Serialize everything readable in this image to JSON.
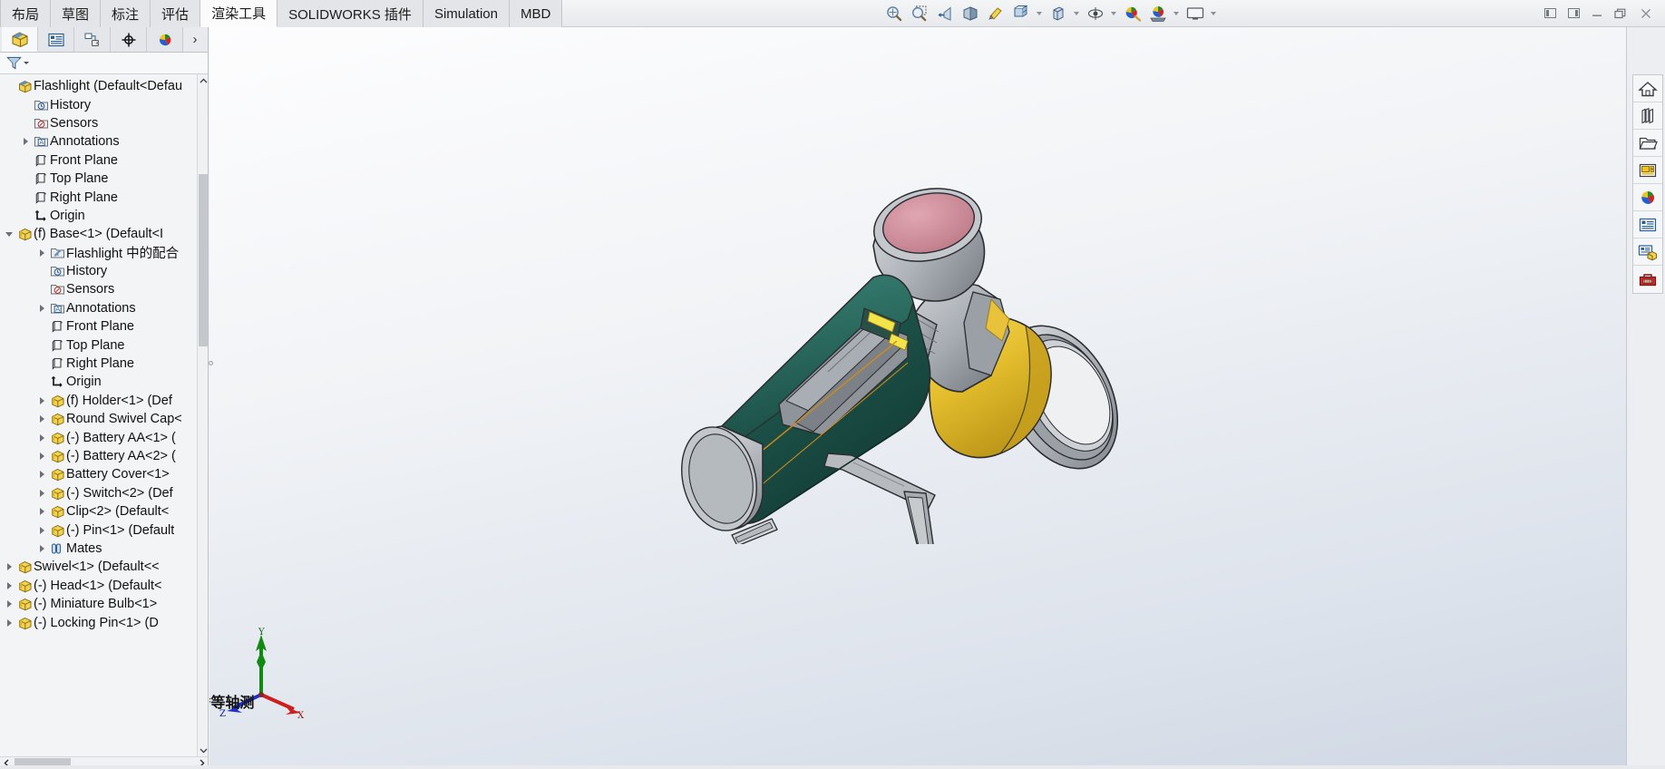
{
  "window": {
    "controls": [
      {
        "name": "restore-left-icon",
        "glyph": "◁"
      },
      {
        "name": "restore-right-icon",
        "glyph": "▷"
      },
      {
        "name": "minimize-icon",
        "glyph": "—"
      },
      {
        "name": "restore-icon",
        "glyph": "❐"
      },
      {
        "name": "close-icon",
        "glyph": "✕"
      }
    ]
  },
  "ribbon": {
    "tabs": [
      {
        "label": "布局",
        "active": false
      },
      {
        "label": "草图",
        "active": false
      },
      {
        "label": "标注",
        "active": false
      },
      {
        "label": "评估",
        "active": false
      },
      {
        "label": "渲染工具",
        "active": true
      },
      {
        "label": "SOLIDWORKS 插件",
        "active": false
      },
      {
        "label": "Simulation",
        "active": false
      },
      {
        "label": "MBD",
        "active": false
      }
    ],
    "toolbar": [
      {
        "name": "zoom-to-fit-icon",
        "caret": false
      },
      {
        "name": "zoom-to-area-icon",
        "caret": false
      },
      {
        "name": "previous-view-icon",
        "caret": false
      },
      {
        "name": "section-view-icon",
        "caret": false
      },
      {
        "name": "view-orientation-icon",
        "caret": false
      },
      {
        "name": "display-style-icon",
        "caret": true
      },
      {
        "name": "hide-show-items-icon",
        "caret": true
      },
      {
        "name": "edit-appearance-icon",
        "caret": true
      },
      {
        "name": "apply-scene-icon",
        "caret": true
      },
      {
        "name": "view-settings-icon",
        "caret": true
      }
    ]
  },
  "feature_manager": {
    "tabs": [
      {
        "name": "feature-tree-tab",
        "active": true
      },
      {
        "name": "property-manager-tab",
        "active": false
      },
      {
        "name": "configuration-manager-tab",
        "active": false
      },
      {
        "name": "dimxpert-manager-tab",
        "active": false
      },
      {
        "name": "display-manager-tab",
        "active": false
      }
    ],
    "more_glyph": "›",
    "filter": {
      "name": "filter-icon",
      "placeholder": ""
    },
    "tree": [
      {
        "depth": 0,
        "arrow": "none",
        "icon": "assembly",
        "label": "Flashlight  (Default<Defau"
      },
      {
        "depth": 1,
        "arrow": "none",
        "icon": "history",
        "label": "History"
      },
      {
        "depth": 1,
        "arrow": "none",
        "icon": "sensors",
        "label": "Sensors"
      },
      {
        "depth": 1,
        "arrow": "right",
        "icon": "annotations",
        "label": "Annotations"
      },
      {
        "depth": 1,
        "arrow": "none",
        "icon": "plane",
        "label": "Front Plane"
      },
      {
        "depth": 1,
        "arrow": "none",
        "icon": "plane",
        "label": "Top Plane"
      },
      {
        "depth": 1,
        "arrow": "none",
        "icon": "plane",
        "label": "Right Plane"
      },
      {
        "depth": 1,
        "arrow": "none",
        "icon": "origin",
        "label": "Origin"
      },
      {
        "depth": 0,
        "arrow": "down",
        "icon": "part",
        "label": "(f) Base<1> (Default<I"
      },
      {
        "depth": 2,
        "arrow": "right",
        "icon": "matefolder",
        "label": "Flashlight 中的配合"
      },
      {
        "depth": 2,
        "arrow": "none",
        "icon": "history",
        "label": "History"
      },
      {
        "depth": 2,
        "arrow": "none",
        "icon": "sensors",
        "label": "Sensors"
      },
      {
        "depth": 2,
        "arrow": "right",
        "icon": "annotations",
        "label": "Annotations"
      },
      {
        "depth": 2,
        "arrow": "none",
        "icon": "plane",
        "label": "Front Plane"
      },
      {
        "depth": 2,
        "arrow": "none",
        "icon": "plane",
        "label": "Top Plane"
      },
      {
        "depth": 2,
        "arrow": "none",
        "icon": "plane",
        "label": "Right Plane"
      },
      {
        "depth": 2,
        "arrow": "none",
        "icon": "origin",
        "label": "Origin"
      },
      {
        "depth": 2,
        "arrow": "right",
        "icon": "part",
        "label": "(f) Holder<1> (Def"
      },
      {
        "depth": 2,
        "arrow": "right",
        "icon": "part",
        "label": "Round Swivel Cap<"
      },
      {
        "depth": 2,
        "arrow": "right",
        "icon": "part",
        "label": "(-) Battery AA<1> ("
      },
      {
        "depth": 2,
        "arrow": "right",
        "icon": "part",
        "label": "(-) Battery AA<2> ("
      },
      {
        "depth": 2,
        "arrow": "right",
        "icon": "part",
        "label": "Battery Cover<1>"
      },
      {
        "depth": 2,
        "arrow": "right",
        "icon": "part",
        "label": "(-) Switch<2> (Def"
      },
      {
        "depth": 2,
        "arrow": "right",
        "icon": "part",
        "label": "Clip<2> (Default<"
      },
      {
        "depth": 2,
        "arrow": "right",
        "icon": "part",
        "label": "(-) Pin<1> (Default"
      },
      {
        "depth": 2,
        "arrow": "right",
        "icon": "mates",
        "label": "Mates"
      },
      {
        "depth": 0,
        "arrow": "right",
        "icon": "part",
        "label": "Swivel<1> (Default<<"
      },
      {
        "depth": 0,
        "arrow": "right",
        "icon": "part",
        "label": "(-) Head<1> (Default<"
      },
      {
        "depth": 0,
        "arrow": "right",
        "icon": "part",
        "label": "(-) Miniature Bulb<1>"
      },
      {
        "depth": 0,
        "arrow": "right",
        "icon": "part",
        "label": "(-) Locking Pin<1> (D"
      }
    ],
    "scroll": {
      "up_glyph": "⌃",
      "down_glyph": "⌄",
      "left_glyph": "‹",
      "right_glyph": "›"
    }
  },
  "graphics": {
    "view_label": "*等轴测",
    "triad": {
      "x_label": "X",
      "y_label": "Y",
      "z_label": "Z",
      "x_color": "#cc2020",
      "y_color": "#128a12",
      "z_color": "#2030cc"
    },
    "model": {
      "name": "flashlight-assembly",
      "colors": {
        "body_green": "#1d544b",
        "body_green_dark": "#123b34",
        "body_green_light": "#2a6a5e",
        "metal_gray": "#b9bcc0",
        "metal_gray_dark": "#8c9197",
        "metal_gray_light": "#d3d6d9",
        "brass_yellow": "#e8c23a",
        "brass_yellow_dark": "#c79f1e",
        "lens_pink": "#cf8895",
        "highlight_yellow": "#f2e44a",
        "outline": "#2a2d30",
        "edge_orange": "#d28a18"
      }
    }
  },
  "task_pane": {
    "items": [
      {
        "name": "solidworks-resources-icon"
      },
      {
        "name": "design-library-icon"
      },
      {
        "name": "file-explorer-icon"
      },
      {
        "name": "view-palette-icon"
      },
      {
        "name": "appearances-scenes-icon"
      },
      {
        "name": "custom-properties-icon"
      },
      {
        "name": "solidworks-forum-icon"
      },
      {
        "name": "toolbox-icon"
      }
    ]
  }
}
